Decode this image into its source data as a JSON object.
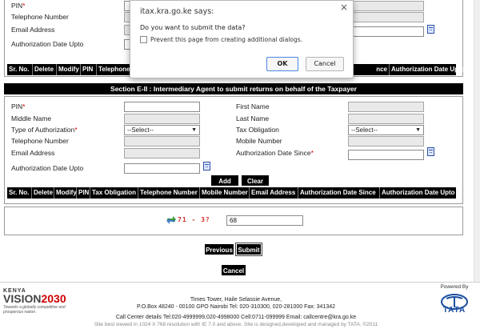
{
  "top_section": {
    "pin_label": "PIN",
    "telephone_label": "Telephone Number",
    "email_label": "Email Address",
    "auth_upto_label": "Authorization Date Upto",
    "table_headers": [
      "Sr. No.",
      "Delete",
      "Modify",
      "PIN",
      "Telephone",
      "nce",
      "Authorization Date Upto"
    ]
  },
  "dialog": {
    "title": "itax.kra.go.ke says:",
    "close_glyph": "×",
    "message": "Do you want to submit the data?",
    "checkbox_label": "Prevent this page from creating additional dialogs.",
    "ok_label": "OK",
    "cancel_label": "Cancel"
  },
  "section_e2": {
    "title": "Section E-II : Intermediary Agent to submit returns on behalf of the Taxpayer",
    "labels": {
      "pin": "PIN",
      "first_name": "First Name",
      "middle_name": "Middle Name",
      "last_name": "Last Name",
      "type_of_authorization": "Type of Authorization",
      "tax_obligation": "Tax Obligation",
      "telephone": "Telephone Number",
      "mobile": "Mobile Number",
      "email": "Email Address",
      "auth_since": "Authorization Date Since",
      "auth_upto": "Authorization Date Upto"
    },
    "select_placeholder": "--Select--",
    "add_label": "Add",
    "clear_label": "Clear",
    "table_headers": [
      "Sr. No.",
      "Delete",
      "Modify",
      "PIN",
      "Tax Obligation",
      "Telephone Number",
      "Mobile Number",
      "Email Address",
      "Authorization Date Since",
      "Authorization Date Upto"
    ]
  },
  "captcha": {
    "code": "71 - 3?",
    "answer": "68"
  },
  "actions": {
    "previous_label": "Previous",
    "submit_label": "Submit",
    "cancel_label": "Cancel"
  },
  "footer": {
    "kenya_line1": "KENYA",
    "kenya_vision": "VISION",
    "kenya_year": "2030",
    "kenya_tagline": "Towards a globally competitive and prosperous nation.",
    "address1": "Times Tower, Haile Selassie Avenue,",
    "address2": "P.O.Box 48240 - 00100 GPO Nairobi Tel: 020-310300, 020-281000 Fax: 341342",
    "contact": "Call Center details Tel:020-4999999,020-4998000 Cell:0711-099999 Email: callcentre@kra.go.ke",
    "best_viewed": "Site best viewed in 1024 X 768 resolution with IE 7.0 and above. Site is designed,developed and managed by TATA. ©2011",
    "powered_by": "Powered By",
    "tata": "TATA"
  },
  "colors": {
    "required": "#d00000",
    "header_bg": "#000000",
    "captcha": "#d83030",
    "tata_blue": "#1b4fa0"
  }
}
